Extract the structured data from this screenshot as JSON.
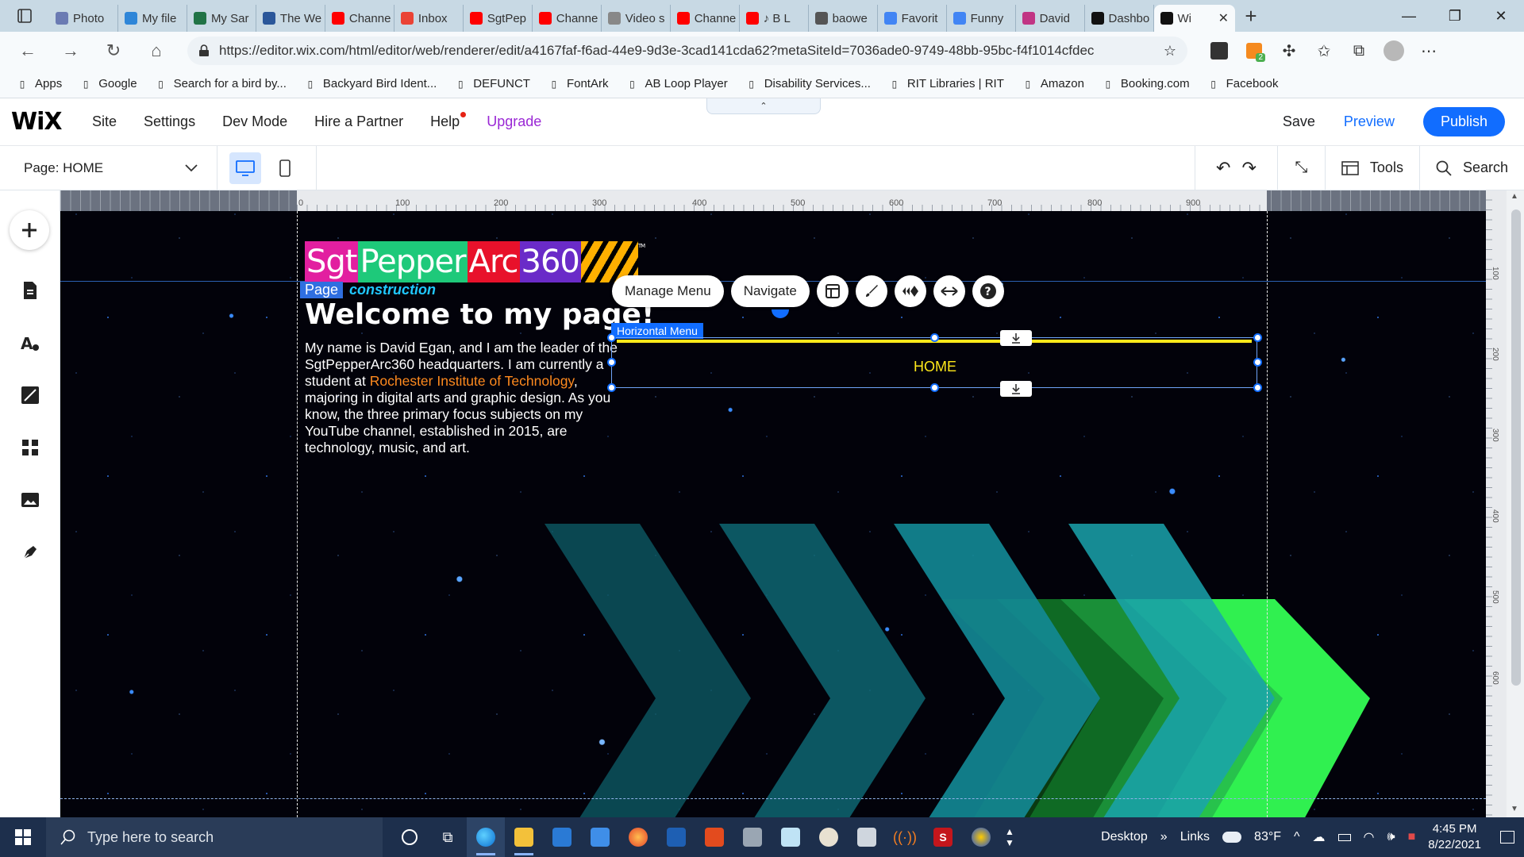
{
  "browser": {
    "tabs": [
      {
        "label": "Photo",
        "fav_color": "#6b7bb3",
        "icon": "photos-icon"
      },
      {
        "label": "My file",
        "fav_color": "#2f86d8",
        "icon": "onedrive-icon"
      },
      {
        "label": "My Sar",
        "fav_color": "#217346",
        "icon": "excel-icon"
      },
      {
        "label": "The We",
        "fav_color": "#2b579a",
        "icon": "word-icon"
      },
      {
        "label": "Channe",
        "fav_color": "#ff0000",
        "icon": "youtube-icon"
      },
      {
        "label": "Inbox",
        "fav_color": "#ea4335",
        "icon": "gmail-icon"
      },
      {
        "label": "SgtPep",
        "fav_color": "#ff0000",
        "icon": "youtube-icon"
      },
      {
        "label": "Channe",
        "fav_color": "#ff0000",
        "icon": "youtube-icon"
      },
      {
        "label": "Video s",
        "fav_color": "#888888",
        "icon": "video-icon"
      },
      {
        "label": "Channe",
        "fav_color": "#ff0000",
        "icon": "youtube-icon"
      },
      {
        "label": "♪ B L",
        "fav_color": "#ff0000",
        "icon": "youtube-icon"
      },
      {
        "label": "baowe",
        "fav_color": "#555555",
        "icon": "github-icon"
      },
      {
        "label": "Favorit",
        "fav_color": "#4285f4",
        "icon": "google-icon"
      },
      {
        "label": "Funny",
        "fav_color": "#4285f4",
        "icon": "docs-icon"
      },
      {
        "label": "David",
        "fav_color": "#c13584",
        "icon": "instagram-icon"
      },
      {
        "label": "Dashbo",
        "fav_color": "#111111",
        "icon": "wix-icon"
      }
    ],
    "active_tab": {
      "label": "Wi",
      "fav_color": "#111111",
      "icon": "wix-icon"
    },
    "url": "https://editor.wix.com/html/editor/web/renderer/edit/a4167faf-f6ad-44e9-9d3e-3cad141cda62?metaSiteId=7036ade0-9749-48bb-95bc-f4f1014cfdec",
    "extension_badge": "2",
    "bookmarks": [
      {
        "label": "Apps",
        "icon": "apps-icon"
      },
      {
        "label": "Google",
        "icon": "google-icon"
      },
      {
        "label": "Search for a bird by...",
        "icon": "bird-icon"
      },
      {
        "label": "Backyard Bird Ident...",
        "icon": "bookmark-icon"
      },
      {
        "label": "DEFUNCT",
        "icon": "defunct-icon"
      },
      {
        "label": "FontArk",
        "icon": "fontark-icon"
      },
      {
        "label": "AB Loop Player",
        "icon": "loop-player-icon"
      },
      {
        "label": "Disability Services...",
        "icon": "rit-icon"
      },
      {
        "label": "RIT Libraries | RIT",
        "icon": "rit-libraries-icon"
      },
      {
        "label": "Amazon",
        "icon": "page-icon"
      },
      {
        "label": "Booking.com",
        "icon": "page-icon"
      },
      {
        "label": "Facebook",
        "icon": "page-icon"
      }
    ]
  },
  "wix": {
    "logo": "WiX",
    "nav": [
      "Site",
      "Settings",
      "Dev Mode",
      "Hire a Partner",
      "Help",
      "Upgrade"
    ],
    "save": "Save",
    "preview": "Preview",
    "publish": "Publish",
    "page_selector": "Page: HOME",
    "tools": "Tools",
    "search": "Search",
    "accent": "#116dff"
  },
  "ruler": {
    "labels": [
      "0",
      "100",
      "200",
      "300",
      "400",
      "500",
      "600",
      "700",
      "800",
      "900"
    ],
    "v_labels": [
      "100",
      "200",
      "300",
      "400",
      "500",
      "600"
    ]
  },
  "site": {
    "logo_parts": [
      "Sgt",
      "Pepper",
      "Arc",
      "360"
    ],
    "logo_colors": [
      "#e21fa0",
      "#1ec97a",
      "#e8112b",
      "#6a2bc8"
    ],
    "logo_tm": "TM",
    "tagline_page": "Page",
    "tagline_rest": "construction",
    "welcome": "Welcome to my page!",
    "bio_1": "My name is David Egan, and I am the leader of the SgtPepperArc360 headquarters. I am currently a student at ",
    "bio_link": "Rochester Institute of Technology",
    "bio_2": ", majoring in digital arts and graphic design. As you know, the three primary focus subjects on my YouTube channel, established in 2015, are technology, music, and art."
  },
  "menu": {
    "manage": "Manage Menu",
    "navigate": "Navigate",
    "label": "Horizontal Menu",
    "item": "HOME"
  },
  "taskbar": {
    "search_placeholder": "Type here to search",
    "desktop": "Desktop",
    "links": "Links",
    "weather": "83°F",
    "time": "4:45 PM",
    "date": "8/22/2021"
  }
}
